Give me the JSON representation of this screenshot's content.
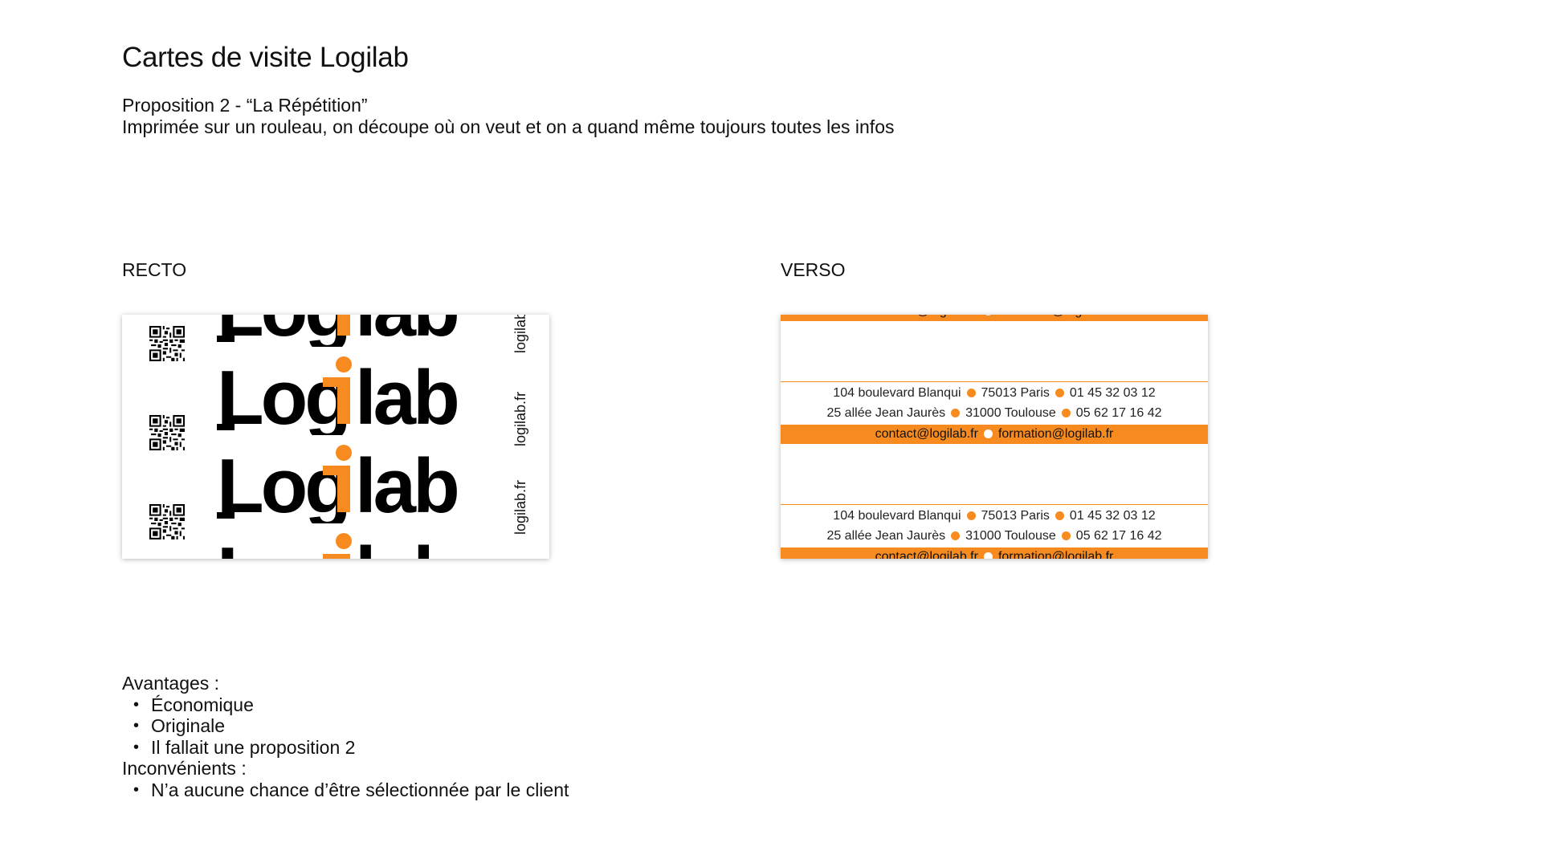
{
  "page": {
    "title": "Cartes de visite Logilab",
    "subtitle_line1": "Proposition 2 - “La Répétition”",
    "subtitle_line2": "Imprimée sur un rouleau, on découpe où on veut et on a quand même toujours toutes les infos"
  },
  "recto": {
    "label": "RECTO",
    "logo_text": "Logilab",
    "logo_letters_left": "Log",
    "logo_letters_right": "lab",
    "side_texts": [
      "logilab",
      "logilab.fr",
      "logilab.fr"
    ]
  },
  "verso": {
    "label": "VERSO",
    "address_paris": {
      "street": "104 boulevard Blanqui",
      "city": "75013 Paris",
      "phone": "01 45 32 03 12"
    },
    "address_toulouse": {
      "street": "25 allée Jean Jaurès",
      "city": "31000 Toulouse",
      "phone": "05 62 17 16 42"
    },
    "emails": {
      "contact": "contact@logilab.fr",
      "formation": "formation@logilab.fr"
    }
  },
  "advantages": {
    "heading": "Avantages :",
    "items": [
      "Économique",
      "Originale",
      "Il fallait une proposition 2"
    ]
  },
  "drawbacks": {
    "heading": "Inconvénients :",
    "items": [
      "N’a aucune chance d’être sélectionnée par le client"
    ]
  },
  "colors": {
    "accent": "#f78b1f",
    "text": "#111111",
    "background": "#ffffff"
  },
  "icons": [
    "qr-code-icon",
    "bullet-dot-icon"
  ]
}
